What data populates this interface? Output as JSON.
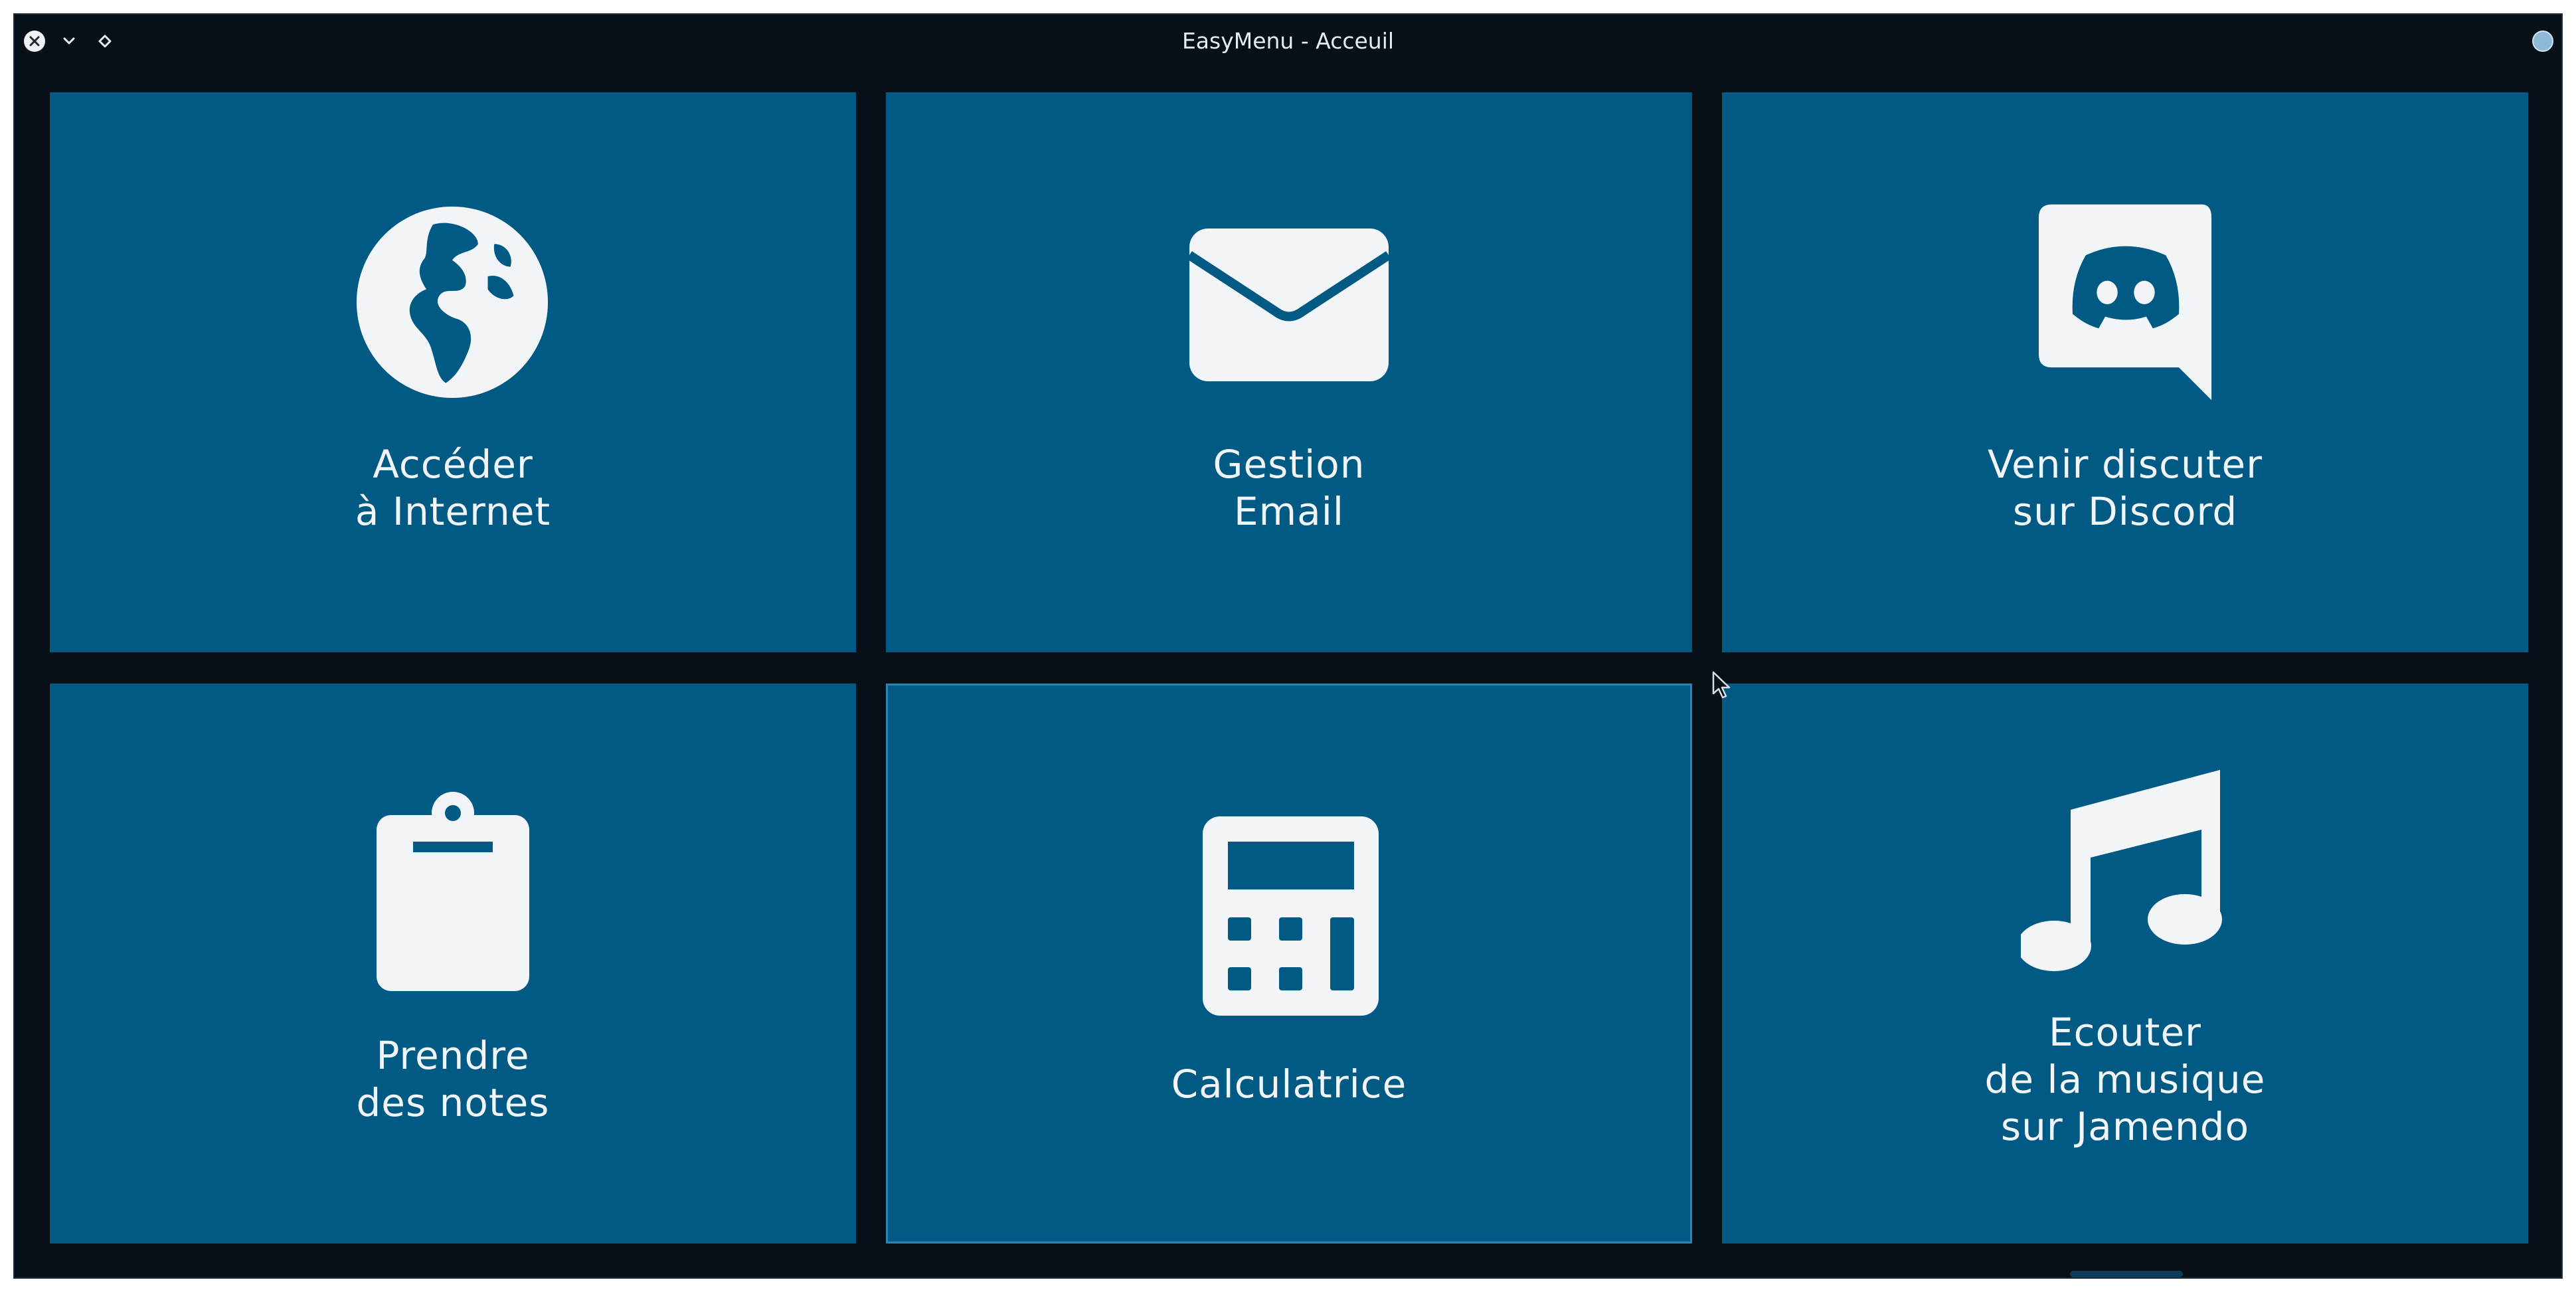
{
  "window": {
    "title": "EasyMenu - Acceuil"
  },
  "colors": {
    "background": "#081017",
    "tile": "#005a84",
    "text": "#f1f5f8"
  },
  "tiles": [
    {
      "label": "Accéder\nà Internet",
      "icon": "globe-icon"
    },
    {
      "label": "Gestion\nEmail",
      "icon": "envelope-icon"
    },
    {
      "label": "Venir discuter\nsur Discord",
      "icon": "discord-icon"
    },
    {
      "label": "Prendre\ndes notes",
      "icon": "clipboard-icon"
    },
    {
      "label": "Calculatrice",
      "icon": "calculator-icon"
    },
    {
      "label": "Ecouter\nde la musique\nsur Jamendo",
      "icon": "music-note-icon"
    }
  ]
}
